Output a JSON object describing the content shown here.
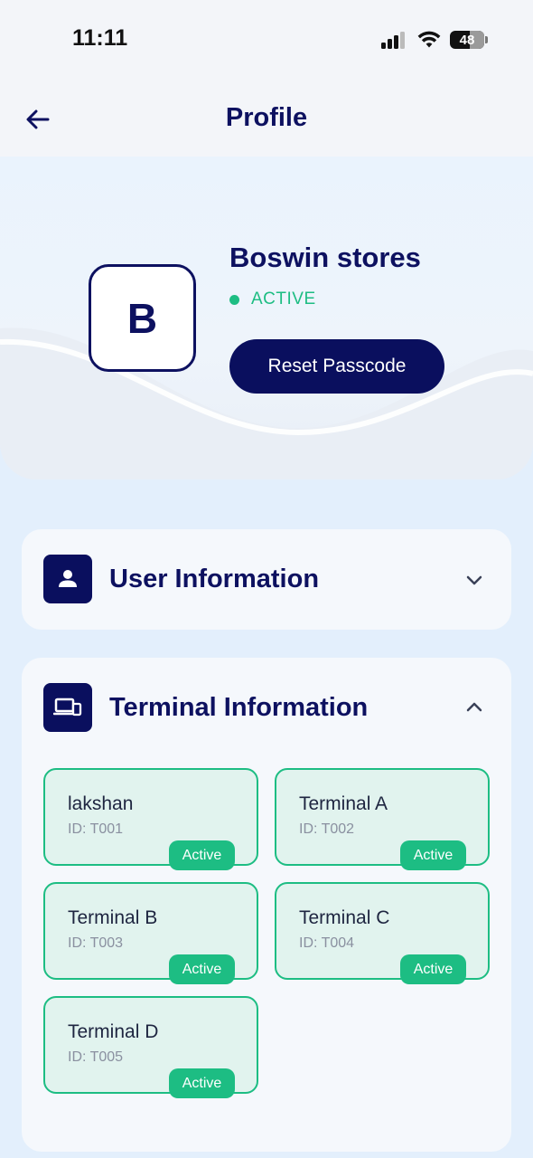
{
  "status_bar": {
    "time": "11:11",
    "battery": "48"
  },
  "header": {
    "title": "Profile",
    "back_icon": "arrow-left-icon"
  },
  "profile": {
    "avatar_letter": "B",
    "store_name": "Boswin stores",
    "status": "ACTIVE",
    "status_color": "#1dbd83",
    "reset_button_label": "Reset Passcode"
  },
  "sections": {
    "user_info": {
      "title": "User Information",
      "icon": "person-icon",
      "expanded": false
    },
    "terminal_info": {
      "title": "Terminal Information",
      "icon": "devices-icon",
      "expanded": true
    }
  },
  "terminals": [
    {
      "name": "lakshan",
      "id": "ID: T001",
      "status": "Active"
    },
    {
      "name": "Terminal A",
      "id": "ID: T002",
      "status": "Active"
    },
    {
      "name": "Terminal B",
      "id": "ID: T003",
      "status": "Active"
    },
    {
      "name": "Terminal C",
      "id": "ID: T004",
      "status": "Active"
    },
    {
      "name": "Terminal D",
      "id": "ID: T005",
      "status": "Active"
    }
  ],
  "colors": {
    "primary": "#0a0f5e",
    "accent": "#1dbd83",
    "background": "#e3effc"
  }
}
